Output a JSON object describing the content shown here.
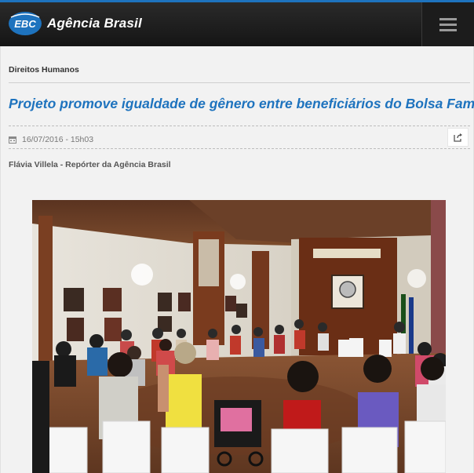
{
  "header": {
    "logo_text": "EBC",
    "brand": "Agência Brasil",
    "logo_icon": "ebc-logo-icon",
    "menu_icon": "hamburger-menu-icon",
    "accent_color": "#1e73be"
  },
  "article": {
    "section": "Direitos Humanos",
    "title": "Projeto promove igualdade de gênero entre beneficiários do Bolsa Família",
    "date": "16/07/2016 - 15h03",
    "date_icon": "calendar-icon",
    "share_icon": "share-icon",
    "author": "Flávia Villela - Repórter da Agência Brasil",
    "photo_description_icon": "article-photo"
  }
}
